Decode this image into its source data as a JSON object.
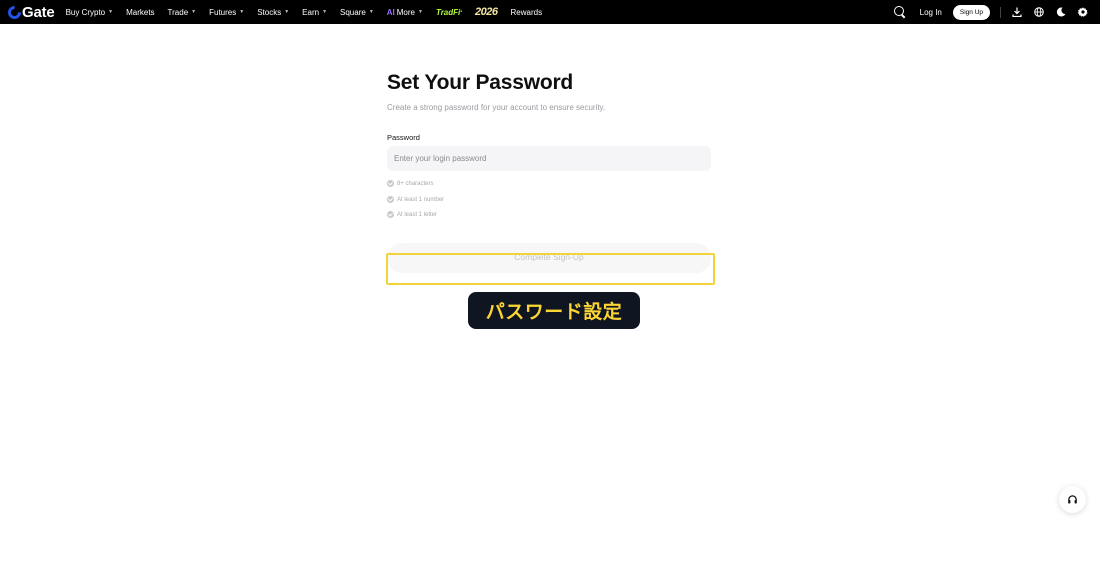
{
  "header": {
    "logo_text": "Gate",
    "nav": [
      {
        "label": "Buy Crypto",
        "caret": true
      },
      {
        "label": "Markets",
        "caret": false
      },
      {
        "label": "Trade",
        "caret": true
      },
      {
        "label": "Futures",
        "caret": true
      },
      {
        "label": "Stocks",
        "caret": true
      },
      {
        "label": "Earn",
        "caret": true
      },
      {
        "label": "Square",
        "caret": true
      }
    ],
    "more_badge": "AI",
    "more_label": "More",
    "tradfi_label": "TradFi",
    "tradfi_mark": "•",
    "year_label": "2026",
    "rewards_label": "Rewards",
    "login_label": "Log In",
    "signup_label": "Sign Up",
    "icons": [
      "search-icon",
      "download-icon",
      "globe-icon",
      "moon-icon",
      "gear-icon"
    ]
  },
  "form": {
    "title": "Set Your Password",
    "subtitle": "Create a strong password for your account to ensure security.",
    "password_label": "Password",
    "password_placeholder": "Enter your login password",
    "password_value": "",
    "rules": [
      "8+ characters",
      "At least 1 number",
      "At least 1 letter"
    ],
    "submit_label": "Complete Sign-Up"
  },
  "annotation": {
    "caption": "パスワード設定",
    "highlight_color": "#f2d33a",
    "caption_color": "#fcd535"
  },
  "support": {
    "icon": "headset-icon"
  }
}
